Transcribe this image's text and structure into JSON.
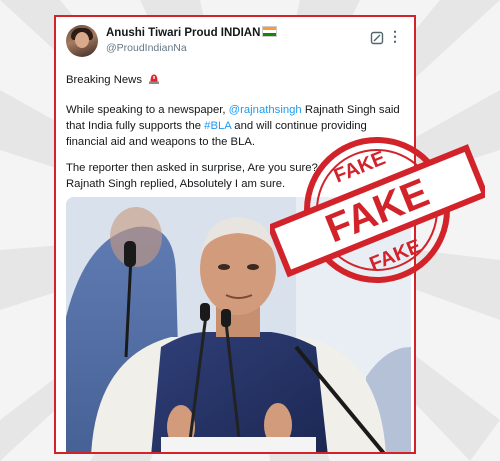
{
  "tweet": {
    "display_name": "Anushi Tiwari Proud INDIAN",
    "handle": "@ProudIndianNa",
    "heading": "Breaking News",
    "para1_before": "While speaking to a newspaper, ",
    "mention": "@rajnathsingh",
    "para1_mid": " Rajnath Singh said that India fully supports the ",
    "hashtag": "#BLA",
    "para1_after": " and will continue providing financial aid and weapons to the BLA.",
    "para2_line1": "The reporter then asked in surprise, Are you sure?",
    "para2_line2": "Rajnath Singh replied, Absolutely I am sure."
  },
  "icons": {
    "siren": "police-light-emoji",
    "flag": "india-flag-emoji",
    "grok": "grok-icon",
    "more": "more-options-icon"
  },
  "stamp": {
    "top": "FAKE",
    "middle": "FAKE",
    "bottom": "FAKE",
    "color": "#d2232a"
  },
  "colors": {
    "frame": "#d2232a",
    "link": "#1d9bf0",
    "text": "#14171a"
  }
}
